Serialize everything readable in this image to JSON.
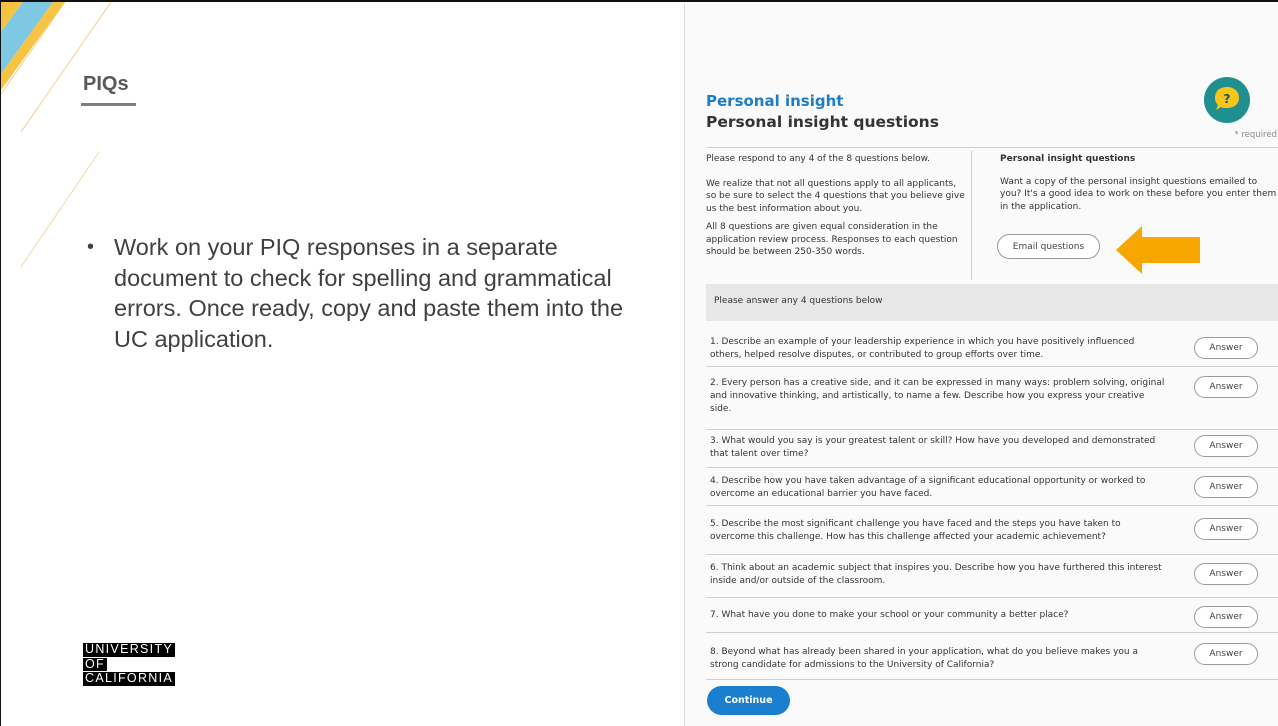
{
  "slide": {
    "title": "PIQs",
    "bullet": "Work on your PIQ responses in a separate document to check for spelling and grammatical errors. Once ready, copy and paste them into the UC application.",
    "logo_lines": [
      "UNIVERSITY",
      "OF",
      "CALIFORNIA"
    ]
  },
  "panel": {
    "section": "Personal insight",
    "title": "Personal insight questions",
    "required_note": "* required",
    "help_icon": "question-bubble-icon",
    "intro_left": [
      "Please respond to any 4 of the 8 questions below.",
      "We realize that not all questions apply to all applicants, so be sure to select the 4 questions that you believe give us the best information about you.",
      "All 8 questions are given equal consideration in the application review process. Responses to each question should be between 250-350 words."
    ],
    "intro_right_title": "Personal insight questions",
    "intro_right_text": "Want a copy of the personal insight questions emailed to you? It's a good idea to work on these before you enter them in the application.",
    "email_button": "Email questions",
    "answer_bar": "Please answer any 4 questions below",
    "answer_label": "Answer",
    "questions": [
      "1. Describe an example of your leadership experience in which you have positively influenced others, helped resolve disputes, or contributed to group efforts over time.",
      "2. Every person has a creative side, and it can be expressed in many ways: problem solving, original and innovative thinking, and artistically, to name a few. Describe how you express your creative side.",
      "3. What would you say is your greatest talent or skill? How have you developed and demonstrated that talent over time?",
      "4. Describe how you have taken advantage of a significant educational opportunity or worked to overcome an educational barrier you have faced.",
      "5. Describe the most significant challenge you have faced and the steps you have taken to overcome this challenge. How has this challenge affected your academic achievement?",
      "6. Think about an academic subject that inspires you. Describe how you have furthered this interest inside and/or outside of the classroom.",
      "7. What have you done to make your school or your community a better place?",
      "8. Beyond what has already been shared in your application, what do you believe makes you a strong candidate for admissions to the University of California?"
    ],
    "continue_button": "Continue"
  },
  "colors": {
    "accent_blue": "#1b7fd0",
    "arrow_orange": "#f7a600",
    "icon_teal": "#1f8f8f",
    "icon_yellow": "#f5c518"
  }
}
